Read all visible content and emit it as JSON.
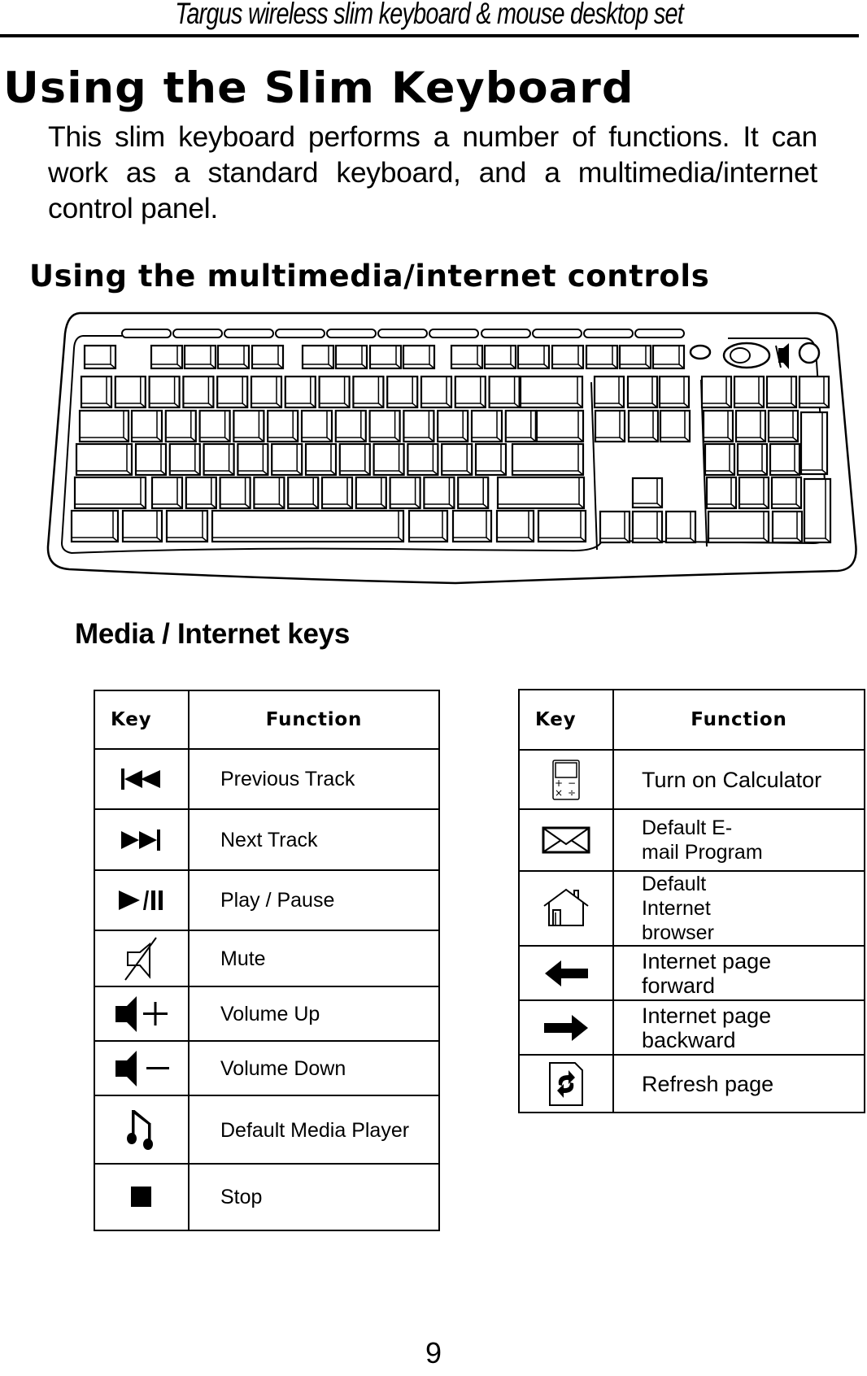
{
  "running_header": "Targus wireless slim keyboard & mouse desktop set",
  "page_title": "Using the Slim Keyboard",
  "intro": "This slim keyboard performs a number of functions. It can work as a standard keyboard, and a multimedia/internet control panel.",
  "section_title": "Using the multimedia/internet controls",
  "illustration": {
    "description": "Line drawing of the Targus slim keyboard",
    "icon": "keyboard-illustration"
  },
  "keys_title": "Media / Internet keys",
  "media_table": {
    "headers": {
      "key": "Key",
      "function": "Function"
    },
    "rows": [
      {
        "icon": "previous-track-icon",
        "function": "Previous Track"
      },
      {
        "icon": "next-track-icon",
        "function": "Next Track"
      },
      {
        "icon": "play-pause-icon",
        "function": "Play / Pause"
      },
      {
        "icon": "mute-icon",
        "function": "Mute"
      },
      {
        "icon": "volume-up-icon",
        "function": "Volume Up"
      },
      {
        "icon": "volume-down-icon",
        "function": "Volume Down"
      },
      {
        "icon": "music-note-icon",
        "function": "Default Media Player"
      },
      {
        "icon": "stop-icon",
        "function": "Stop"
      }
    ]
  },
  "internet_table": {
    "headers": {
      "key": "Key",
      "function": "Function"
    },
    "rows": [
      {
        "icon": "calculator-icon",
        "function": "Turn on Calculator",
        "calc_glyphs": [
          "+",
          "−",
          "×",
          "÷"
        ]
      },
      {
        "icon": "envelope-icon",
        "function": "Default E-mail Program"
      },
      {
        "icon": "home-icon",
        "function": "Default Internet browser"
      },
      {
        "icon": "arrow-left-icon",
        "function": "Internet page forward"
      },
      {
        "icon": "arrow-right-icon",
        "function": "Internet page backward"
      },
      {
        "icon": "refresh-icon",
        "function": "Refresh page"
      }
    ]
  },
  "page_number": "9"
}
